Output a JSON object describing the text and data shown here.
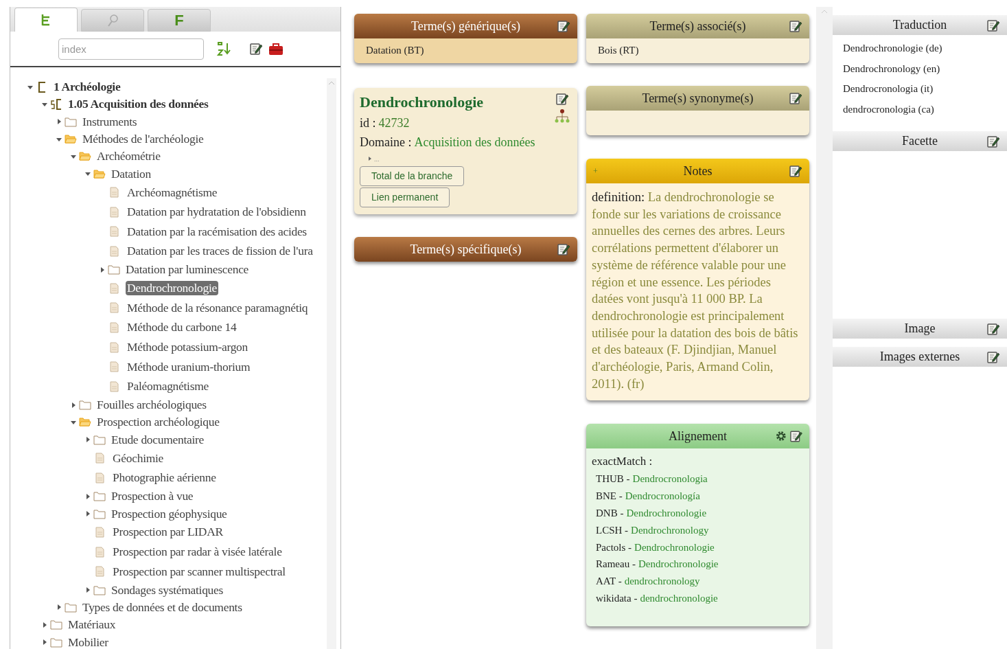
{
  "sidebar": {
    "tabs": [
      {
        "kind": "tree",
        "selected": true
      },
      {
        "kind": "search",
        "selected": false
      },
      {
        "kind": "facet",
        "label": "F",
        "selected": false
      }
    ],
    "search": {
      "placeholder": "index"
    },
    "tree": [
      {
        "label": "1 Archéologie",
        "kind": "root",
        "expanded": true,
        "selected": false,
        "children": [
          {
            "label": "1.05 Acquisition des données",
            "kind": "group",
            "expanded": true,
            "selected": false,
            "children": [
              {
                "label": "Instruments",
                "kind": "folder",
                "expanded": false,
                "selected": false
              },
              {
                "label": "Méthodes de l'archéologie",
                "kind": "folder",
                "expanded": true,
                "selected": false,
                "children": [
                  {
                    "label": "Archéométrie",
                    "kind": "folder",
                    "expanded": true,
                    "selected": false,
                    "children": [
                      {
                        "label": "Datation",
                        "kind": "folder",
                        "expanded": true,
                        "selected": false,
                        "children": [
                          {
                            "label": "Archéomagnétisme",
                            "kind": "term",
                            "selected": false
                          },
                          {
                            "label": "Datation par hydratation de l'obsidienn",
                            "kind": "term",
                            "selected": false
                          },
                          {
                            "label": "Datation par la racémisation des acides",
                            "kind": "term",
                            "selected": false
                          },
                          {
                            "label": "Datation par les traces de fission de l'ura",
                            "kind": "term",
                            "selected": false
                          },
                          {
                            "label": "Datation par luminescence",
                            "kind": "folder",
                            "expanded": false,
                            "selected": false
                          },
                          {
                            "label": "Dendrochronologie",
                            "kind": "term",
                            "selected": true
                          },
                          {
                            "label": "Méthode de la résonance paramagnétiq",
                            "kind": "term",
                            "selected": false
                          },
                          {
                            "label": "Méthode du carbone 14",
                            "kind": "term",
                            "selected": false
                          },
                          {
                            "label": "Méthode potassium-argon",
                            "kind": "term",
                            "selected": false
                          },
                          {
                            "label": "Méthode uranium-thorium",
                            "kind": "term",
                            "selected": false
                          },
                          {
                            "label": "Paléomagnétisme",
                            "kind": "term",
                            "selected": false
                          }
                        ]
                      }
                    ]
                  },
                  {
                    "label": "Fouilles archéologiques",
                    "kind": "folder",
                    "expanded": false,
                    "selected": false
                  },
                  {
                    "label": "Prospection archéologique",
                    "kind": "folder",
                    "expanded": true,
                    "selected": false,
                    "children": [
                      {
                        "label": "Etude documentaire",
                        "kind": "folder",
                        "expanded": false,
                        "selected": false
                      },
                      {
                        "label": "Géochimie",
                        "kind": "term",
                        "selected": false
                      },
                      {
                        "label": "Photographie aérienne",
                        "kind": "term",
                        "selected": false
                      },
                      {
                        "label": "Prospection à vue",
                        "kind": "folder",
                        "expanded": false,
                        "selected": false
                      },
                      {
                        "label": "Prospection géophysique",
                        "kind": "folder",
                        "expanded": false,
                        "selected": false
                      },
                      {
                        "label": "Prospection par LIDAR",
                        "kind": "term",
                        "selected": false
                      },
                      {
                        "label": "Prospection par radar à visée latérale",
                        "kind": "term",
                        "selected": false
                      },
                      {
                        "label": "Prospection par scanner multispectral",
                        "kind": "term",
                        "selected": false
                      },
                      {
                        "label": "Sondages systématiques",
                        "kind": "folder",
                        "expanded": false,
                        "selected": false
                      }
                    ]
                  }
                ]
              },
              {
                "label": "Types de données et de documents",
                "kind": "folder",
                "expanded": false,
                "selected": false
              }
            ]
          },
          {
            "label": "Matériaux",
            "kind": "folder",
            "expanded": false,
            "selected": false
          },
          {
            "label": "Mobilier",
            "kind": "folder",
            "expanded": false,
            "selected": false
          }
        ]
      }
    ]
  },
  "generic_terms": {
    "title": "Terme(s) générique(s)",
    "items": [
      "Datation (BT)"
    ]
  },
  "concept": {
    "title": "Dendrochronologie",
    "id_label": "id :",
    "id": "42732",
    "domain_label": "Domaine :",
    "domain": "Acquisition des données",
    "expander": "...",
    "buttons": [
      "Total de la branche",
      "Lien permanent"
    ]
  },
  "specific_terms": {
    "title": "Terme(s) spécifique(s)"
  },
  "associated_terms": {
    "title": "Terme(s) associé(s)",
    "items": [
      "Bois (RT)"
    ]
  },
  "synonyms": {
    "title": "Terme(s) synonyme(s)"
  },
  "notes": {
    "toggle": "+",
    "title": "Notes",
    "label": "definition:",
    "text": "La dendrochronologie se fonde sur les variations de croissance annuelles des cernes des arbres. Leurs corrélations permettent d'élaborer un système de référence valable pour une région et une essence. Les périodes datées vont jusqu'à 11 000 BP. La dendrochronologie est principalement utilisée pour la datation des bois de bâtis et des bateaux (F. Djindjian, Manuel d'archéologie, Paris, Armand Colin, 2011). (fr)"
  },
  "alignment": {
    "title": "Alignement",
    "match_label": "exactMatch :",
    "matches": [
      {
        "source": "THUB -",
        "term": "Dendrocronologia"
      },
      {
        "source": "BNE -",
        "term": "Dendrocronología"
      },
      {
        "source": "DNB -",
        "term": "Dendrochronologie"
      },
      {
        "source": "LCSH -",
        "term": "Dendrochronology"
      },
      {
        "source": "Pactols -",
        "term": "Dendrochronologie"
      },
      {
        "source": "Rameau -",
        "term": "Dendrochronologie"
      },
      {
        "source": "AAT -",
        "term": "dendrochronology"
      },
      {
        "source": "wikidata -",
        "term": "dendrochronologie"
      }
    ]
  },
  "right_panel": {
    "sections": [
      {
        "title": "Traduction",
        "items": [
          "Dendrochronologie (de)",
          "Dendrochronology (en)",
          "Dendrocronologia (it)",
          "dendrocronologia (ca)"
        ]
      },
      {
        "title": "Facette"
      },
      {
        "title": "Image"
      },
      {
        "title": "Images externes"
      }
    ]
  }
}
